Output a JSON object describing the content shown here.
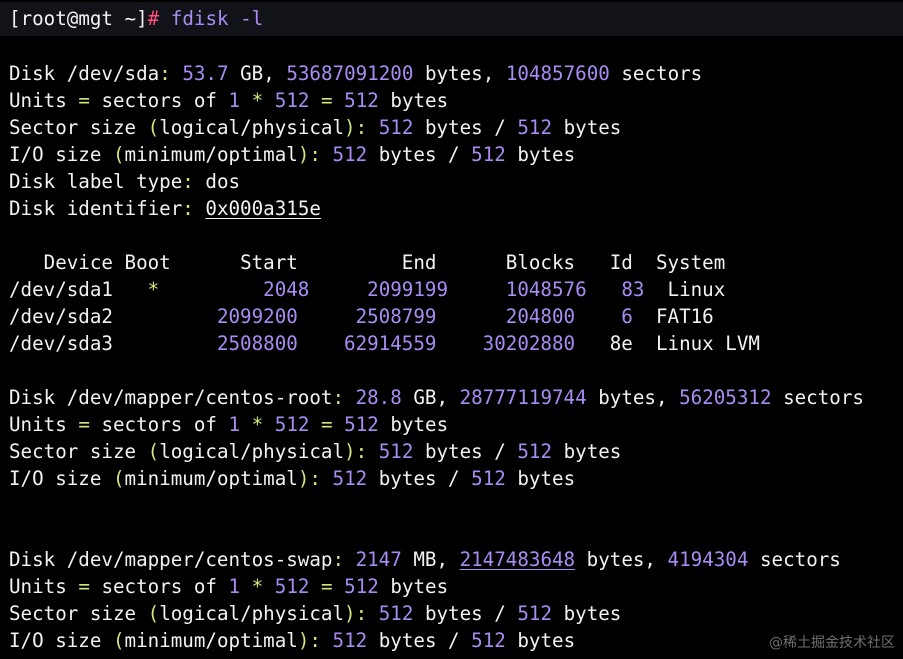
{
  "prompt": {
    "bracket_open": "[",
    "user_host": "root@mgt",
    "space": " ",
    "dir": "~",
    "bracket_close": "]",
    "hash": "#",
    "command": "fdisk -l"
  },
  "disk_sda": {
    "label": "Disk /dev/sda",
    "colon": ":",
    "size": "53.7",
    "size_unit": "GB,",
    "bytes": "53687091200",
    "bytes_label": "bytes,",
    "sectors": "104857600",
    "sectors_label": "sectors",
    "units_label": "Units",
    "equals1": "=",
    "units_text": "sectors of",
    "one": "1",
    "star": "*",
    "sector_val": "512",
    "equals2": "=",
    "sector_bytes": "512",
    "bytes_word": "bytes",
    "sector_size_label": "Sector size",
    "sector_size_paren": "(logical/physical)",
    "sector_size_logical": "512",
    "sector_size_physical": "512",
    "io_label": "I/O size",
    "io_paren": "(minimum/optimal)",
    "io_min": "512",
    "io_opt": "512",
    "label_type_label": "Disk label type",
    "label_type": "dos",
    "identifier_label": "Disk identifier",
    "identifier": "0x000a315e"
  },
  "partition_table": {
    "headers": [
      "Device",
      "Boot",
      "Start",
      "End",
      "Blocks",
      "Id",
      "System"
    ],
    "rows": [
      {
        "device": "/dev/sda1",
        "boot": "*",
        "start": "2048",
        "end": "2099199",
        "blocks": "1048576",
        "id": "83",
        "system": "Linux"
      },
      {
        "device": "/dev/sda2",
        "boot": "",
        "start": "2099200",
        "end": "2508799",
        "blocks": "204800",
        "id": "6",
        "system": "FAT16"
      },
      {
        "device": "/dev/sda3",
        "boot": "",
        "start": "2508800",
        "end": "62914559",
        "blocks": "30202880",
        "id": "8e",
        "system": "Linux LVM"
      }
    ]
  },
  "disk_root": {
    "label": "Disk /dev/mapper/centos-root",
    "size": "28.8",
    "size_unit": "GB,",
    "bytes": "28777119744",
    "sectors": "56205312"
  },
  "disk_swap": {
    "label": "Disk /dev/mapper/centos-swap",
    "size": "2147",
    "size_unit": "MB,",
    "bytes": "2147483648",
    "sectors": "4194304"
  },
  "common": {
    "bytes_label": "bytes,",
    "sectors_label": "sectors",
    "slash": "/"
  },
  "watermark": "@稀土掘金技术社区",
  "colors": {
    "background": "#000000",
    "prompt_bar": "#111318",
    "text": "#f2f2f2",
    "number": "#a98cf2",
    "symbol": "#cfe87d",
    "hash": "#ff4f7a"
  }
}
